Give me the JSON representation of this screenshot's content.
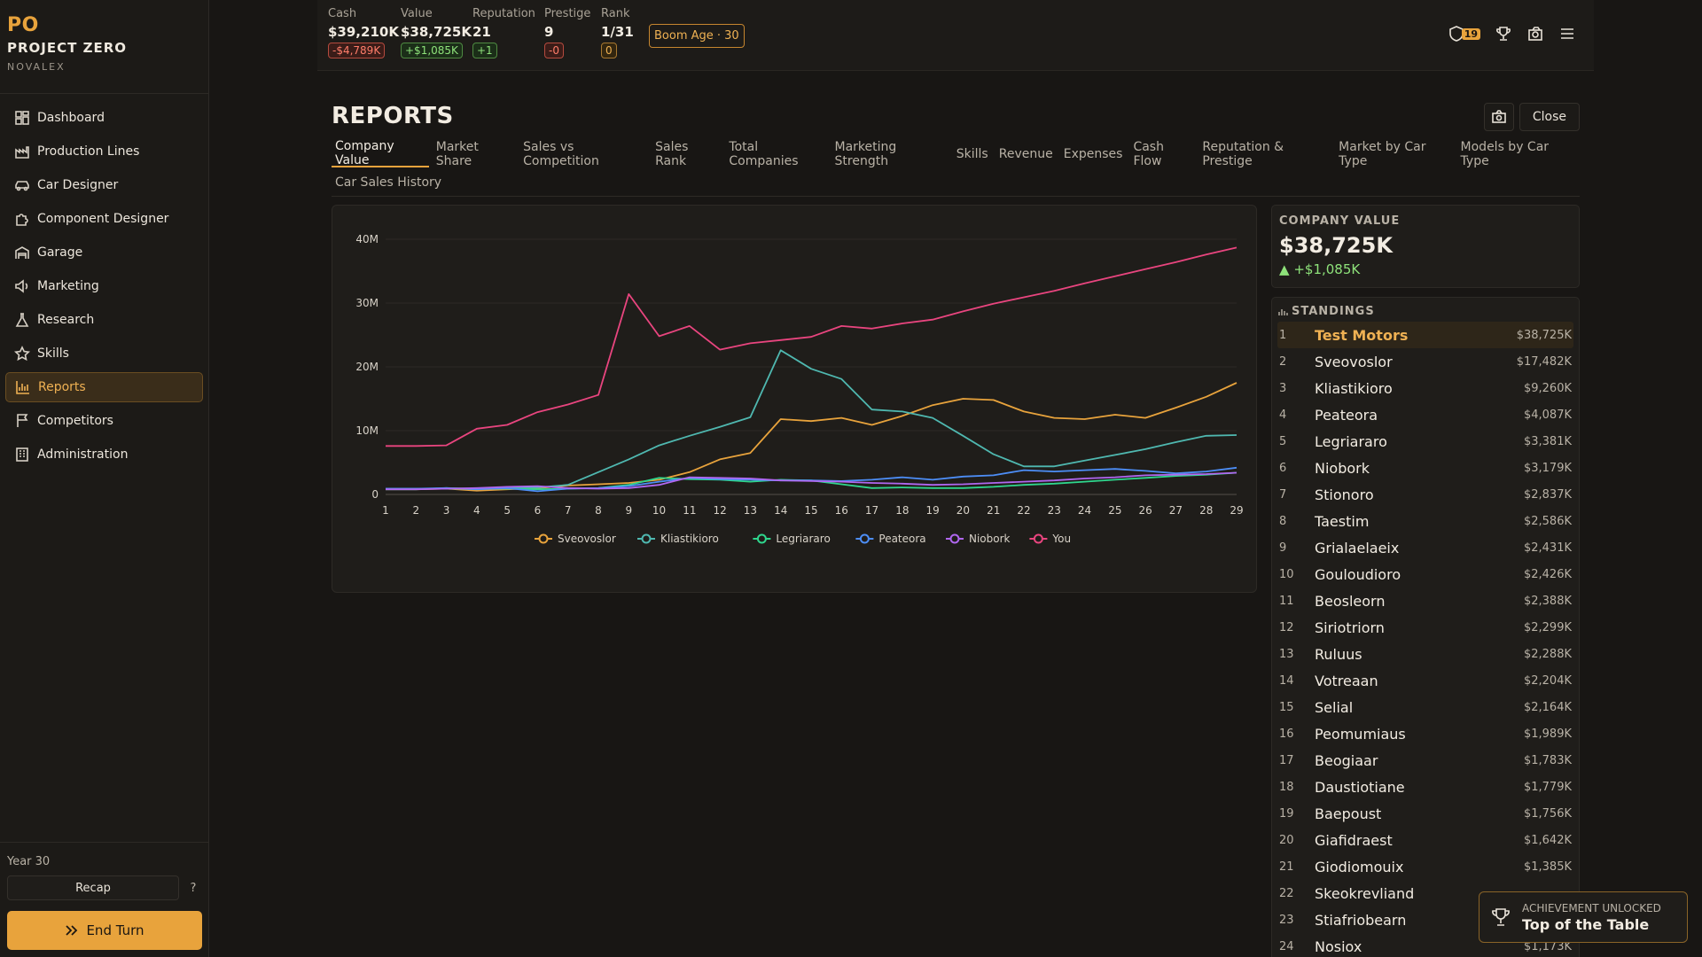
{
  "brand": {
    "logo": "PO",
    "name": "PROJECT ZERO",
    "sub": "NOVALEX"
  },
  "nav": [
    {
      "label": "Dashboard",
      "icon": "dashboard-icon"
    },
    {
      "label": "Production Lines",
      "icon": "factory-icon"
    },
    {
      "label": "Car Designer",
      "icon": "car-icon"
    },
    {
      "label": "Component Designer",
      "icon": "puzzle-icon"
    },
    {
      "label": "Garage",
      "icon": "garage-icon"
    },
    {
      "label": "Marketing",
      "icon": "megaphone-icon"
    },
    {
      "label": "Research",
      "icon": "flask-icon"
    },
    {
      "label": "Skills",
      "icon": "star-icon"
    },
    {
      "label": "Reports",
      "icon": "bar-chart-icon",
      "active": true
    },
    {
      "label": "Competitors",
      "icon": "flag-icon"
    },
    {
      "label": "Administration",
      "icon": "building-icon"
    }
  ],
  "sidebar_bottom": {
    "year": "Year 30",
    "recap": "Recap",
    "help": "?",
    "end_turn": "End Turn"
  },
  "top": {
    "cash": {
      "label": "Cash",
      "value": "$39,210K",
      "change": "-$4,789K"
    },
    "value": {
      "label": "Value",
      "value": "$38,725K",
      "change": "+$1,085K"
    },
    "reputation": {
      "label": "Reputation",
      "value": "21",
      "change": "+1"
    },
    "prestige": {
      "label": "Prestige",
      "value": "9",
      "change": "-0"
    },
    "rank": {
      "label": "Rank",
      "value": "1/31",
      "change": "0"
    },
    "boom": "Boom Age · 30",
    "notifications": "19"
  },
  "page": {
    "title": "REPORTS",
    "close": "Close"
  },
  "tabs_row1": [
    "Company Value",
    "Market Share",
    "Sales vs Competition",
    "Sales Rank",
    "Total Companies",
    "Marketing Strength",
    "Skills",
    "Revenue",
    "Expenses",
    "Cash Flow",
    "Reputation & Prestige",
    "Market by Car Type",
    "Models by Car Type"
  ],
  "tabs_row2": [
    "Car Sales History"
  ],
  "value_card": {
    "label": "COMPANY VALUE",
    "value": "$38,725K",
    "delta": "+$1,085K"
  },
  "standings": {
    "title": "STANDINGS",
    "rows": [
      {
        "rank": "1",
        "name": "Test Motors",
        "value": "$38,725K"
      },
      {
        "rank": "2",
        "name": "Sveovoslor",
        "value": "$17,482K"
      },
      {
        "rank": "3",
        "name": "Kliastikioro",
        "value": "$9,260K"
      },
      {
        "rank": "4",
        "name": "Peateora",
        "value": "$4,087K"
      },
      {
        "rank": "5",
        "name": "Legriararo",
        "value": "$3,381K"
      },
      {
        "rank": "6",
        "name": "Niobork",
        "value": "$3,179K"
      },
      {
        "rank": "7",
        "name": "Stionoro",
        "value": "$2,837K"
      },
      {
        "rank": "8",
        "name": "Taestim",
        "value": "$2,586K"
      },
      {
        "rank": "9",
        "name": "Grialaelaeix",
        "value": "$2,431K"
      },
      {
        "rank": "10",
        "name": "Gouloudioro",
        "value": "$2,426K"
      },
      {
        "rank": "11",
        "name": "Beosleorn",
        "value": "$2,388K"
      },
      {
        "rank": "12",
        "name": "Siriotriorn",
        "value": "$2,299K"
      },
      {
        "rank": "13",
        "name": "Ruluus",
        "value": "$2,288K"
      },
      {
        "rank": "14",
        "name": "Votreaan",
        "value": "$2,204K"
      },
      {
        "rank": "15",
        "name": "Selial",
        "value": "$2,164K"
      },
      {
        "rank": "16",
        "name": "Peomumiaus",
        "value": "$1,989K"
      },
      {
        "rank": "17",
        "name": "Beogiaar",
        "value": "$1,783K"
      },
      {
        "rank": "18",
        "name": "Daustiotiane",
        "value": "$1,779K"
      },
      {
        "rank": "19",
        "name": "Baepoust",
        "value": "$1,756K"
      },
      {
        "rank": "20",
        "name": "Giafidraest",
        "value": "$1,642K"
      },
      {
        "rank": "21",
        "name": "Giodiomouix",
        "value": "$1,385K"
      },
      {
        "rank": "22",
        "name": "Skeokrevliand",
        "value": ""
      },
      {
        "rank": "23",
        "name": "Stiafriobearn",
        "value": ""
      },
      {
        "rank": "24",
        "name": "Nosiox",
        "value": "$1,173K"
      }
    ]
  },
  "toast": {
    "line1": "ACHIEVEMENT UNLOCKED",
    "line2": "Top of the Table"
  },
  "chart_data": {
    "type": "line",
    "x": [
      1,
      2,
      3,
      4,
      5,
      6,
      7,
      8,
      9,
      10,
      11,
      12,
      13,
      14,
      15,
      16,
      17,
      18,
      19,
      20,
      21,
      22,
      23,
      24,
      25,
      26,
      27,
      28,
      29
    ],
    "yticks": [
      "0",
      "10M",
      "20M",
      "30M",
      "40M"
    ],
    "ylim": [
      0,
      40
    ],
    "legend_position": "bottom",
    "series": [
      {
        "name": "Sveovoslor",
        "color": "#e8a33c",
        "values": [
          0.8,
          0.8,
          0.9,
          0.6,
          0.8,
          1.0,
          1.4,
          1.6,
          1.8,
          2.3,
          3.5,
          5.5,
          6.5,
          11.8,
          11.5,
          12.0,
          10.9,
          12.3,
          14.0,
          15.0,
          14.8,
          13.0,
          12.0,
          11.8,
          12.5,
          12.0,
          13.6,
          15.3,
          17.5
        ]
      },
      {
        "name": "Kliastikioro",
        "color": "#4fb8b0",
        "values": [
          0.9,
          0.9,
          0.9,
          0.9,
          1.0,
          1.1,
          1.5,
          3.5,
          5.5,
          7.7,
          9.2,
          10.6,
          12.1,
          22.6,
          19.7,
          18.1,
          13.3,
          13.0,
          12.0,
          9.2,
          6.3,
          4.4,
          4.4,
          5.3,
          6.2,
          7.1,
          8.2,
          9.2,
          9.3
        ]
      },
      {
        "name": "Legriararo",
        "color": "#2fd68d",
        "values": [
          0.8,
          0.8,
          1.0,
          0.9,
          0.9,
          0.8,
          0.9,
          1.0,
          1.5,
          2.6,
          2.4,
          2.3,
          2.0,
          2.3,
          2.2,
          1.6,
          1.0,
          1.1,
          1.0,
          1.0,
          1.2,
          1.5,
          1.7,
          2.0,
          2.3,
          2.6,
          2.9,
          3.1,
          3.4
        ]
      },
      {
        "name": "Peateora",
        "color": "#4d8ef7",
        "values": [
          0.9,
          0.9,
          1.0,
          0.8,
          1.0,
          0.5,
          0.9,
          1.0,
          1.3,
          2.0,
          2.6,
          2.4,
          2.3,
          2.2,
          2.2,
          2.1,
          2.3,
          2.7,
          2.3,
          2.8,
          3.0,
          3.8,
          3.6,
          3.8,
          4.0,
          3.7,
          3.3,
          3.6,
          4.2
        ]
      },
      {
        "name": "Niobork",
        "color": "#b067f0",
        "values": [
          0.8,
          0.8,
          0.9,
          1.0,
          1.2,
          1.3,
          1.0,
          0.9,
          1.0,
          1.5,
          2.7,
          2.6,
          2.5,
          2.2,
          2.1,
          2.0,
          1.8,
          1.7,
          1.5,
          1.6,
          1.8,
          2.0,
          2.2,
          2.5,
          2.7,
          3.0,
          3.1,
          3.2,
          3.4
        ]
      },
      {
        "name": "You",
        "color": "#e9457f",
        "values": [
          7.6,
          7.6,
          7.7,
          10.3,
          10.9,
          12.9,
          14.1,
          15.6,
          31.4,
          24.8,
          26.4,
          22.7,
          23.7,
          24.2,
          24.7,
          26.4,
          26.0,
          26.8,
          27.4,
          28.7,
          29.9,
          30.9,
          31.9,
          33.1,
          34.2,
          35.3,
          36.4,
          37.6,
          38.7
        ]
      }
    ]
  }
}
